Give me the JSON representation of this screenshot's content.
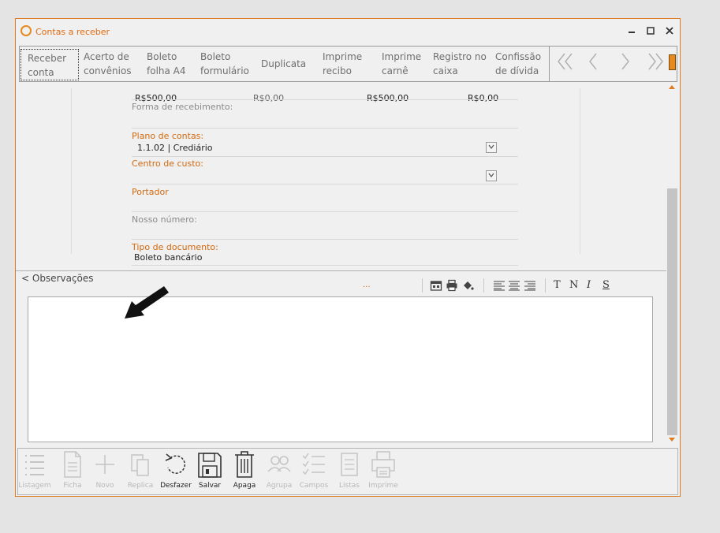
{
  "window": {
    "title": "Contas a receber",
    "accent_color": "#e07a1f",
    "controls": {
      "minimize": "▬",
      "maximize": "▢",
      "close": "✕"
    }
  },
  "toolbar": {
    "items": [
      {
        "line1": "Receber",
        "line2": "conta",
        "selected": true
      },
      {
        "line1": "Acerto de",
        "line2": "convênios"
      },
      {
        "line1": "Boleto",
        "line2": "folha A4"
      },
      {
        "line1": "Boleto",
        "line2": "formulário"
      },
      {
        "line1": "Duplicata",
        "line2": ""
      },
      {
        "line1": "Imprime",
        "line2": "recibo"
      },
      {
        "line1": "Imprime",
        "line2": "carnê"
      },
      {
        "line1": "Registro no",
        "line2": "caixa"
      },
      {
        "line1": "Confissão",
        "line2": "de dívida"
      }
    ],
    "nav": {
      "first": "«",
      "prev": "‹",
      "next": "›",
      "last": "»"
    }
  },
  "values_row": [
    "R$500,00",
    "R$0,00",
    "R$500,00",
    "R$0,00"
  ],
  "form": {
    "forma_recebimento": {
      "label": "Forma de recebimento:",
      "value": ""
    },
    "plano_contas": {
      "label": "Plano de contas:",
      "value": "1.1.02 | Crediário"
    },
    "centro_custo": {
      "label": "Centro de custo:",
      "value": ""
    },
    "portador": {
      "label": "Portador",
      "value": ""
    },
    "nosso_numero": {
      "label": "Nosso número:",
      "value": ""
    },
    "tipo_documento": {
      "label": "Tipo de documento:",
      "value": "Boleto bancário"
    }
  },
  "observacoes": {
    "label": "< Observações",
    "ellipsis": "...",
    "format_buttons": {
      "t": "T",
      "n": "N",
      "i": "I",
      "s": "S"
    }
  },
  "bottom_toolbar": {
    "items": [
      {
        "label": "Listagem",
        "icon": "list-icon",
        "active": false
      },
      {
        "label": "Ficha",
        "icon": "document-icon",
        "active": false
      },
      {
        "label": "Novo",
        "icon": "plus-icon",
        "active": false
      },
      {
        "label": "Replica",
        "icon": "copy-icon",
        "active": false
      },
      {
        "label": "Desfazer",
        "icon": "undo-icon",
        "active": true
      },
      {
        "label": "Salvar",
        "icon": "floppy-icon",
        "active": true
      },
      {
        "label": "Apaga",
        "icon": "trash-icon",
        "active": true
      },
      {
        "label": "Agrupa",
        "icon": "group-icon",
        "active": false
      },
      {
        "label": "Campos",
        "icon": "checklist-icon",
        "active": false
      },
      {
        "label": "Listas",
        "icon": "lists-icon",
        "active": false
      },
      {
        "label": "Imprime",
        "icon": "printer-icon",
        "active": false
      }
    ]
  }
}
